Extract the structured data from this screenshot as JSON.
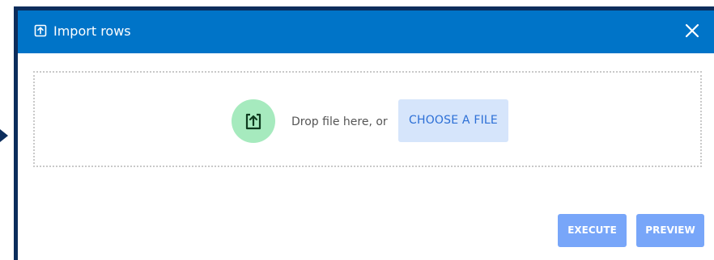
{
  "dialog": {
    "title": "Import rows",
    "title_icon": "upload-icon",
    "close_icon": "close-icon"
  },
  "dropzone": {
    "icon": "upload-icon",
    "prompt": "Drop file here, or",
    "choose_label": "CHOOSE A FILE"
  },
  "actions": {
    "execute_label": "EXECUTE",
    "preview_label": "PREVIEW"
  },
  "colors": {
    "header": "#0074c8",
    "frame": "#0c2d5c",
    "upload_circle": "#a6eabe",
    "choose_bg": "#d6e5fb",
    "choose_text": "#2c6fd6",
    "action_bg": "#78a6f9"
  }
}
